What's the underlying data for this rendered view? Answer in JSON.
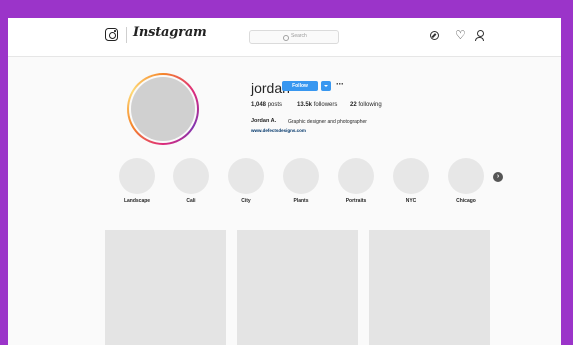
{
  "header": {
    "brand": "Instagram",
    "search_placeholder": "Search",
    "icons": [
      "instagram-logo-icon",
      "search-icon",
      "compass-icon",
      "heart-icon",
      "user-icon"
    ]
  },
  "profile": {
    "username": "jordan",
    "follow_label": "Follow",
    "more_label": "···",
    "stats": {
      "posts_count": "1,048",
      "posts_label": "posts",
      "followers_count": "13.5k",
      "followers_label": "followers",
      "following_count": "22",
      "following_label": "following"
    },
    "full_name": "Jordan A.",
    "bio": "Graphic designer and photographer",
    "website": "www.defectsdesigns.com"
  },
  "highlights": [
    "Landscape",
    "Cali",
    "City",
    "Plants",
    "Portraits",
    "NYC",
    "Chicago"
  ],
  "colors": {
    "background": "#9b34c9",
    "accent_blue": "#3897f0",
    "link": "#003569",
    "placeholder_gray": "#d0d0d0"
  }
}
